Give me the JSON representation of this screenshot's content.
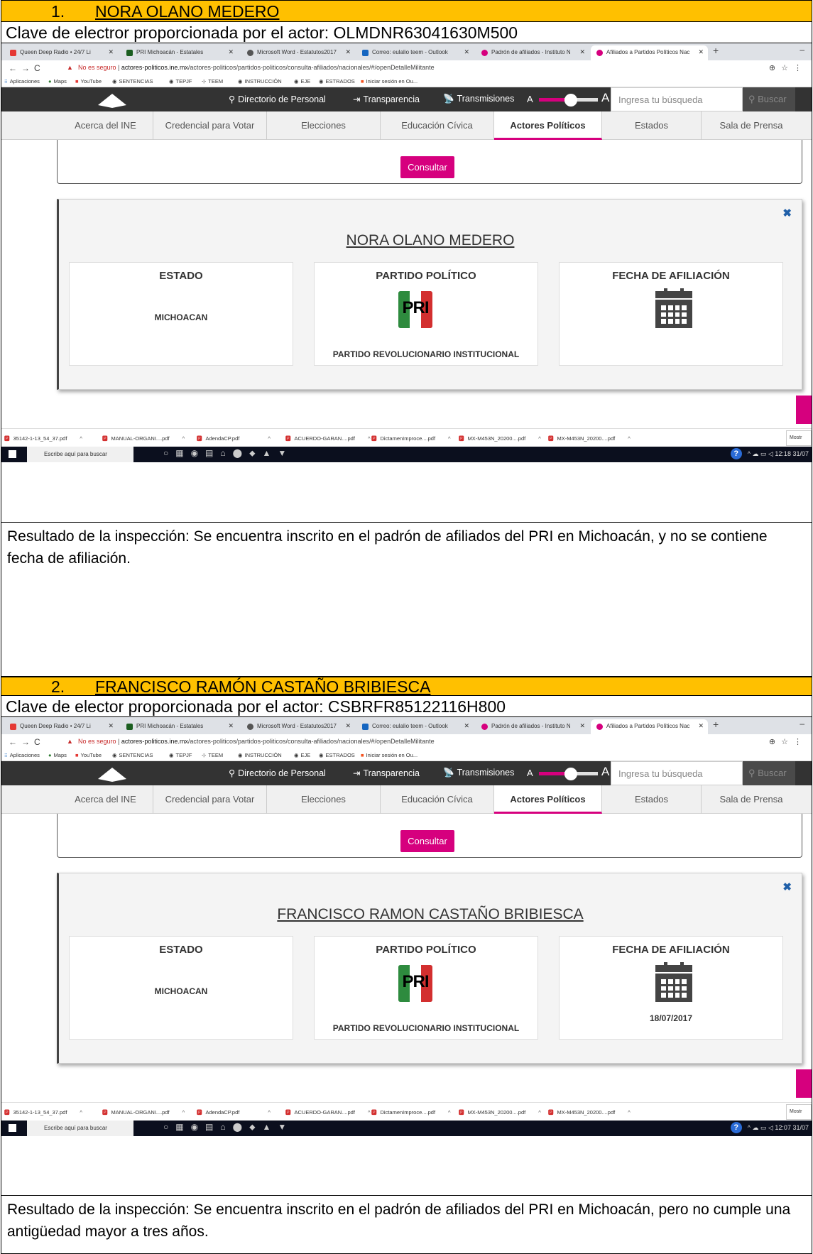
{
  "entries": [
    {
      "number": "1.",
      "name": "NORA OLANO MEDERO",
      "clave": "Clave de electror proporcionada por el actor: OLMDNR63041630M500",
      "detail_name": "NORA OLANO MEDERO",
      "estado": "MICHOACAN",
      "fecha": "",
      "time": "12:18",
      "date": "31/07",
      "result": "Resultado de la inspección: Se encuentra inscrito en el padrón de afiliados del PRI en Michoacán, y no se contiene fecha de afiliación."
    },
    {
      "number": "2.",
      "name": "FRANCISCO RAMÓN CASTAÑO BRIBIESCA",
      "clave": "Clave de elector proporcionada por el actor: CSBRFR85122116H800",
      "detail_name": "FRANCISCO RAMON CASTAÑO BRIBIESCA",
      "estado": "MICHOACAN",
      "fecha": "18/07/2017",
      "time": "12:07",
      "date": "31/07",
      "result": "Resultado de la inspección: Se encuentra inscrito en el padrón de afiliados del PRI en Michoacán, pero no cumple una antigüedad mayor a tres años."
    }
  ],
  "browser": {
    "tabs": [
      "Queen Deep Radio • 24/7 Li",
      "PRI Michoacán - Estatales",
      "Microsoft Word - Estatutos2017",
      "Correo: eulalio teem - Outlook",
      "Padrón de afiliados - Instituto N",
      "Afiliados a Partidos Políticos Nac"
    ],
    "insecure": "No es seguro",
    "url_domain": "actores-politicos.ine.mx",
    "url_path": "/actores-politicos/partidos-politicos/consulta-afiliados/nacionales/#/openDetalleMilitante",
    "bookmarks": [
      "Aplicaciones",
      "Maps",
      "YouTube",
      "SENTENCIAS",
      "TEPJF",
      "TEEM",
      "INSTRUCCIÓN",
      "EJE",
      "ESTRADOS",
      "Iniciar sesión en Ou..."
    ]
  },
  "ine": {
    "directorio": "Directorio de Personal",
    "transparencia": "Transparencia",
    "transmisiones": "Transmisiones",
    "font_small": "A",
    "font_big": "A",
    "search_placeholder": "Ingresa tu búsqueda",
    "search_button": "Buscar",
    "menu": [
      "Acerca del INE",
      "Credencial para Votar",
      "Elecciones",
      "Educación Cívica",
      "Actores Políticos",
      "Estados",
      "Sala de Prensa"
    ],
    "consultar": "Consultar",
    "estado_title": "ESTADO",
    "partido_title": "PARTIDO POLÍTICO",
    "fecha_title": "FECHA DE AFILIACIÓN",
    "partido_name": "PARTIDO REVOLUCIONARIO INSTITUCIONAL",
    "pri_logo": "PRI"
  },
  "downloads": [
    "35142-1-13_54_37.pdf",
    "MANUAL-ORGANI....pdf",
    "AdendaCP.pdf",
    "ACUERDO-GARAN....pdf",
    "DictamenImproce....pdf",
    "MX-M453N_20200....pdf",
    "MX-M453N_20200....pdf"
  ],
  "downloads_more": "Mostr",
  "taskbar": {
    "search": "Escribe aquí para buscar"
  }
}
